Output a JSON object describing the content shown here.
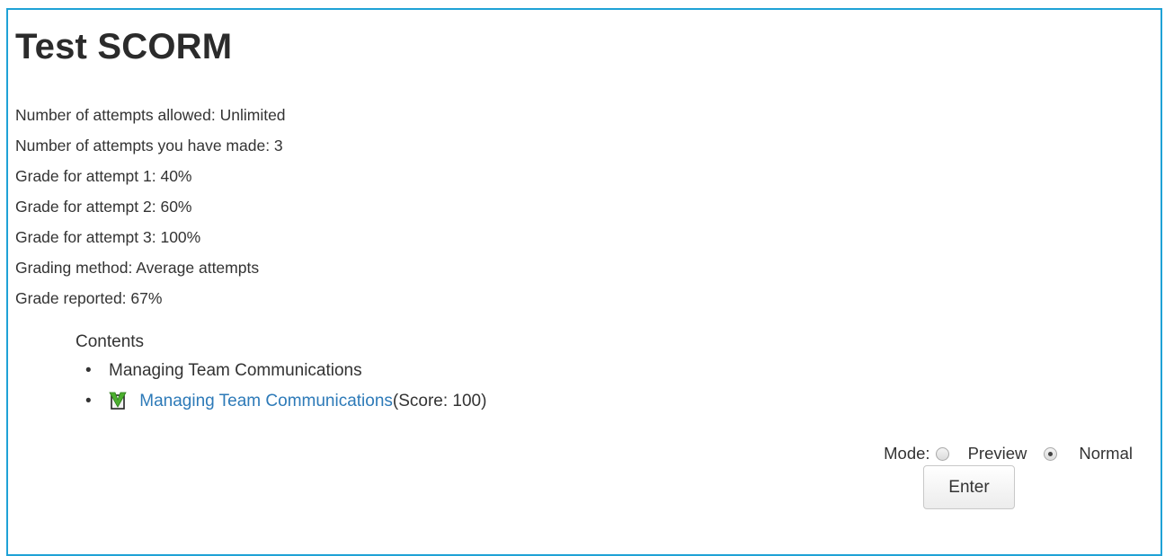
{
  "page": {
    "title": "Test SCORM"
  },
  "info": {
    "lines": [
      "Number of attempts allowed: Unlimited",
      "Number of attempts you have made: 3",
      "Grade for attempt 1: 40%",
      "Grade for attempt 2: 60%",
      "Grade for attempt 3: 100%",
      "Grading method: Average attempts",
      "Grade reported: 67%"
    ]
  },
  "toc": {
    "title": "Contents",
    "items": [
      {
        "bullet": "•",
        "label": "Managing Team Communications"
      },
      {
        "bullet": "•",
        "link": "Managing Team Communications",
        "score": "(Score: 100)",
        "status_icon": "passed-checkmark-icon"
      }
    ]
  },
  "mode": {
    "label": "Mode:",
    "options": [
      {
        "label": "Preview",
        "checked": false
      },
      {
        "label": "Normal",
        "checked": true
      }
    ]
  },
  "enter": {
    "label": "Enter"
  },
  "colors": {
    "frame_border": "#1fa2d6",
    "link": "#2d7ab8",
    "check_green": "#4caf2f"
  }
}
